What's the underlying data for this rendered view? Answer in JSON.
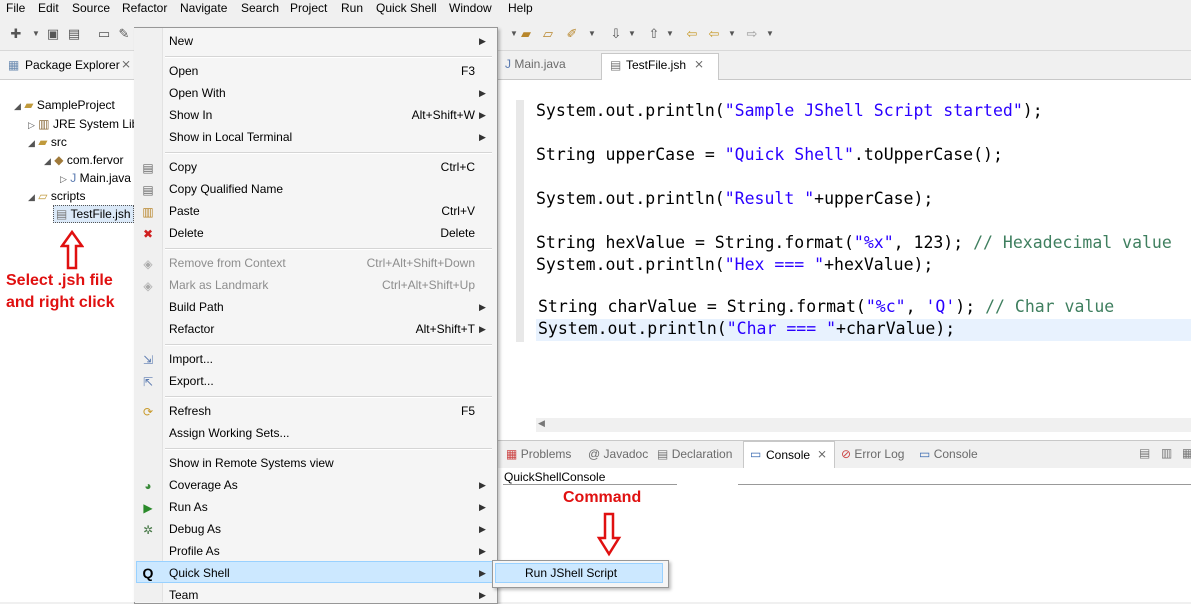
{
  "menubar": [
    "File",
    "Edit",
    "Source",
    "Refactor",
    "Navigate",
    "Search",
    "Project",
    "Run",
    "Quick Shell",
    "Window",
    "Help"
  ],
  "package_explorer": {
    "tab_label": "Package Explorer",
    "tree": {
      "project": "SampleProject",
      "jre": "JRE System Lib",
      "src": "src",
      "package": "com.fervor",
      "main_file": "Main.java",
      "scripts": "scripts",
      "test_file": "TestFile.jsh"
    }
  },
  "annotations": {
    "instruction_line1": "Select .jsh file",
    "instruction_line2": "and right click",
    "command_label": "Command"
  },
  "context_menu": {
    "new": "New",
    "open": "Open",
    "open_sc": "F3",
    "open_with": "Open With",
    "show_in": "Show In",
    "show_in_sc": "Alt+Shift+W",
    "show_local_terminal": "Show in Local Terminal",
    "copy": "Copy",
    "copy_sc": "Ctrl+C",
    "copy_qualified": "Copy Qualified Name",
    "paste": "Paste",
    "paste_sc": "Ctrl+V",
    "delete": "Delete",
    "delete_sc": "Delete",
    "remove_from_context": "Remove from Context",
    "remove_from_context_sc": "Ctrl+Alt+Shift+Down",
    "mark_landmark": "Mark as Landmark",
    "mark_landmark_sc": "Ctrl+Alt+Shift+Up",
    "build_path": "Build Path",
    "refactor": "Refactor",
    "refactor_sc": "Alt+Shift+T",
    "import": "Import...",
    "export": "Export...",
    "refresh": "Refresh",
    "refresh_sc": "F5",
    "assign_working_sets": "Assign Working Sets...",
    "show_remote": "Show in Remote Systems view",
    "coverage_as": "Coverage As",
    "run_as": "Run As",
    "debug_as": "Debug As",
    "profile_as": "Profile As",
    "quick_shell": "Quick Shell",
    "team": "Team"
  },
  "submenu": {
    "run_jshell": "Run JShell Script"
  },
  "editor": {
    "tabs": [
      "Main.java",
      "TestFile.jsh"
    ],
    "lines": {
      "l1a": "System.out.println(",
      "l1s": "\"Sample JShell Script started\"",
      "l1b": ");",
      "l2a": "String upperCase = ",
      "l2s": "\"Quick Shell\"",
      "l2b": ".toUpperCase();",
      "l3a": "System.out.println(",
      "l3s": "\"Result \"",
      "l3b": "+upperCase);",
      "l4a": "String hexValue = String.format(",
      "l4s": "\"%x\"",
      "l4b": ", 123); ",
      "l4c": "// Hexadecimal value",
      "l5a": "System.out.println(",
      "l5s": "\"Hex === \"",
      "l5b": "+hexValue);",
      "l6a": "String charValue = String.format(",
      "l6s": "\"%c\"",
      "l6m": ", ",
      "l6q": "'Q'",
      "l6b": "); ",
      "l6c": "// Char value",
      "l7a": "System.out.println(",
      "l7s": "\"Char === \"",
      "l7b": "+charValue);"
    }
  },
  "console": {
    "tabs": {
      "problems": "Problems",
      "javadoc": "Javadoc",
      "declaration": "Declaration",
      "console": "Console",
      "error_log": "Error Log",
      "console2": "Console"
    },
    "name": "QuickShellConsole"
  },
  "colors": {
    "string": "#2a00ff",
    "comment": "#3f7f5f",
    "annotation": "#e01010",
    "selection": "#cce8ff"
  }
}
